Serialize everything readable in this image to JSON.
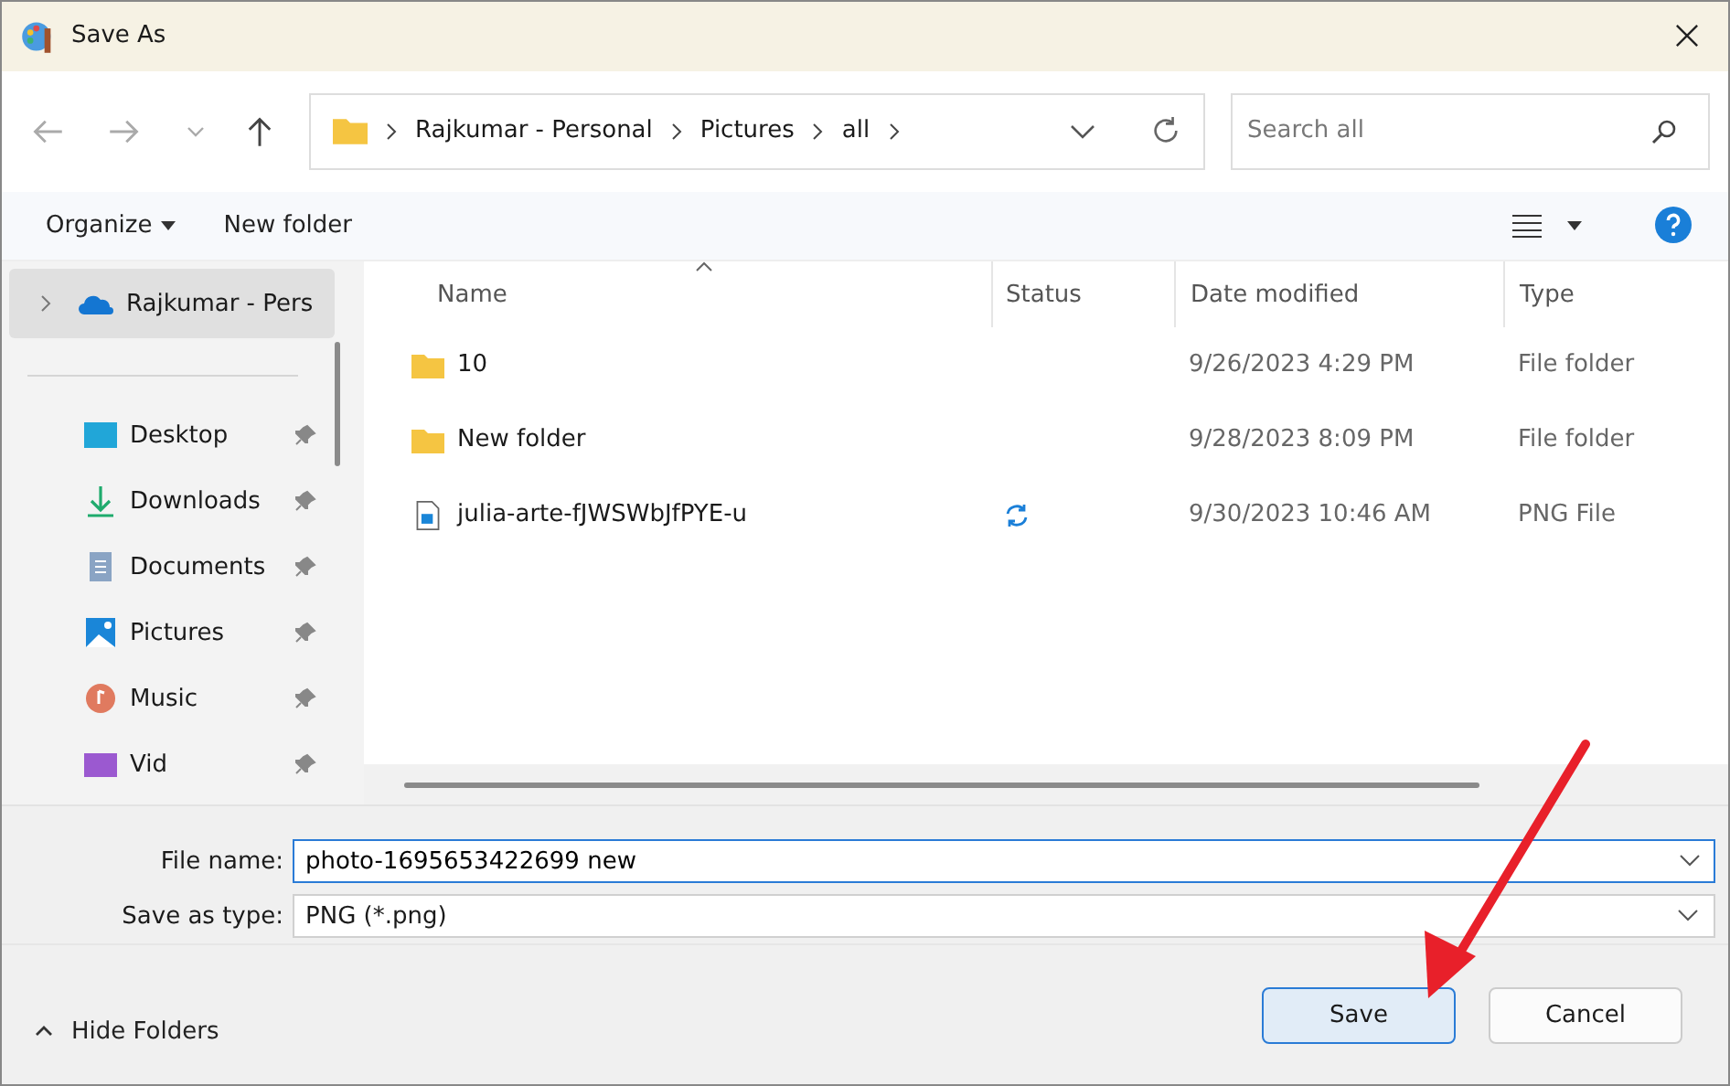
{
  "window": {
    "title": "Save As"
  },
  "address": {
    "crumbs": [
      "Rajkumar - Personal",
      "Pictures",
      "all"
    ]
  },
  "search": {
    "placeholder": "Search all"
  },
  "toolbar": {
    "organize": "Organize",
    "new_folder": "New folder"
  },
  "sidebar": {
    "items": [
      {
        "label": "Rajkumar - Pers",
        "kind": "cloud",
        "selected": true,
        "pinned": false
      },
      {
        "label": "Desktop",
        "kind": "desktop",
        "selected": false,
        "pinned": true
      },
      {
        "label": "Downloads",
        "kind": "downloads",
        "selected": false,
        "pinned": true
      },
      {
        "label": "Documents",
        "kind": "documents",
        "selected": false,
        "pinned": true
      },
      {
        "label": "Pictures",
        "kind": "pictures",
        "selected": false,
        "pinned": true
      },
      {
        "label": "Music",
        "kind": "music",
        "selected": false,
        "pinned": true
      },
      {
        "label": "Vid",
        "kind": "videos",
        "selected": false,
        "pinned": true
      }
    ]
  },
  "table": {
    "columns": [
      "Name",
      "Status",
      "Date modified",
      "Type"
    ],
    "rows": [
      {
        "name": "10",
        "kind": "folder",
        "syncing": false,
        "date": "9/26/2023 4:29 PM",
        "type": "File folder"
      },
      {
        "name": "New folder",
        "kind": "folder",
        "syncing": false,
        "date": "9/28/2023 8:09 PM",
        "type": "File folder"
      },
      {
        "name": "julia-arte-fJWSWbJfPYE-u",
        "kind": "image",
        "syncing": true,
        "date": "9/30/2023 10:46 AM",
        "type": "PNG File"
      }
    ]
  },
  "form": {
    "file_name_label": "File name:",
    "file_name": "photo-1695653422699 new",
    "type_label": "Save as type:",
    "type": "PNG (*.png)"
  },
  "hide_folders": "Hide Folders",
  "buttons": [
    {
      "label": "Save",
      "kind": "primary"
    },
    {
      "label": "Cancel",
      "kind": "secondary"
    }
  ]
}
